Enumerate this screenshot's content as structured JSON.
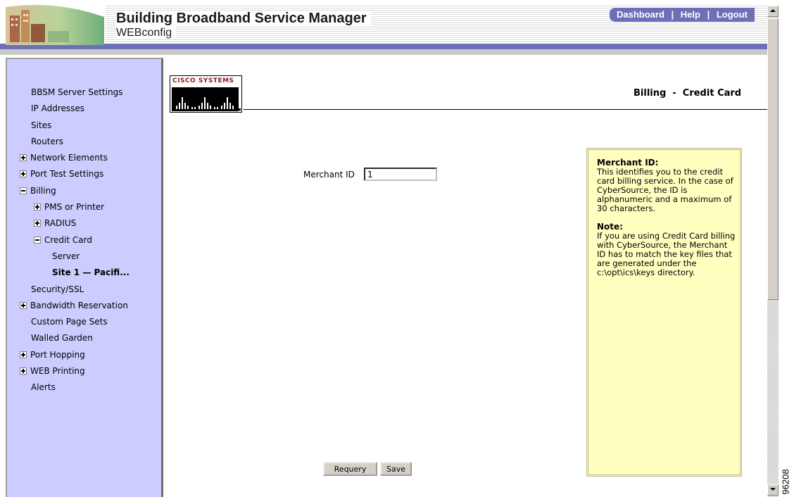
{
  "header": {
    "title": "Building Broadband Service Manager",
    "subtitle": "WEBconfig",
    "links": [
      "Dashboard",
      "Help",
      "Logout"
    ],
    "link_separator": "|"
  },
  "sidebar": {
    "items": [
      {
        "label": "BBSM Server Settings",
        "level": 0,
        "toggle": "none",
        "bold": false
      },
      {
        "label": "IP Addresses",
        "level": 0,
        "toggle": "none",
        "bold": false
      },
      {
        "label": "Sites",
        "level": 0,
        "toggle": "none",
        "bold": false
      },
      {
        "label": "Routers",
        "level": 0,
        "toggle": "none",
        "bold": false
      },
      {
        "label": "Network Elements",
        "level": 0,
        "toggle": "plus",
        "bold": false
      },
      {
        "label": "Port Test Settings",
        "level": 0,
        "toggle": "plus",
        "bold": false
      },
      {
        "label": "Billing",
        "level": 0,
        "toggle": "minus",
        "bold": false
      },
      {
        "label": "PMS or Printer",
        "level": 1,
        "toggle": "plus",
        "bold": false
      },
      {
        "label": "RADIUS",
        "level": 1,
        "toggle": "plus",
        "bold": false
      },
      {
        "label": "Credit Card",
        "level": 1,
        "toggle": "minus",
        "bold": false
      },
      {
        "label": "Server",
        "level": 2,
        "toggle": "none",
        "bold": false
      },
      {
        "label": "Site 1 — Pacifi...",
        "level": 2,
        "toggle": "none",
        "bold": true
      },
      {
        "label": "Security/SSL",
        "level": 0,
        "toggle": "none",
        "bold": false
      },
      {
        "label": "Bandwidth Reservation",
        "level": 0,
        "toggle": "plus",
        "bold": false
      },
      {
        "label": "Custom Page Sets",
        "level": 0,
        "toggle": "none",
        "bold": false
      },
      {
        "label": "Walled Garden",
        "level": 0,
        "toggle": "none",
        "bold": false
      },
      {
        "label": "Port Hopping",
        "level": 0,
        "toggle": "plus",
        "bold": false
      },
      {
        "label": "WEB Printing",
        "level": 0,
        "toggle": "plus",
        "bold": false
      },
      {
        "label": "Alerts",
        "level": 0,
        "toggle": "none",
        "bold": false
      }
    ]
  },
  "main": {
    "logo_text": "Cisco Systems",
    "page_title": "Billing  -  Credit Card",
    "merchant_label": "Merchant ID",
    "merchant_value": "1",
    "buttons": {
      "requery": "Requery",
      "save": "Save"
    }
  },
  "help": {
    "heading1": "Merchant ID:",
    "text1": "This identifies you to the credit card billing service. In the case of CyberSource, the ID is alphanumeric and a maximum of 30 characters.",
    "heading2": "Note:",
    "text2": "If you are using Credit Card billing with CyberSource, the Merchant ID has to match the key files that are generated under the c:\\opt\\ics\\keys directory."
  },
  "figure_id": "96208",
  "colors": {
    "sidebar_bg": "#ccccff",
    "header_band": "#6d6fb8",
    "help_bg": "#ffffc0",
    "cisco_red": "#8b1a1a"
  },
  "icons": [
    "building-logo-image",
    "cisco-bridge-logo",
    "tree-expand-icon",
    "tree-collapse-icon",
    "scroll-up-arrow-icon",
    "scroll-down-arrow-icon"
  ]
}
